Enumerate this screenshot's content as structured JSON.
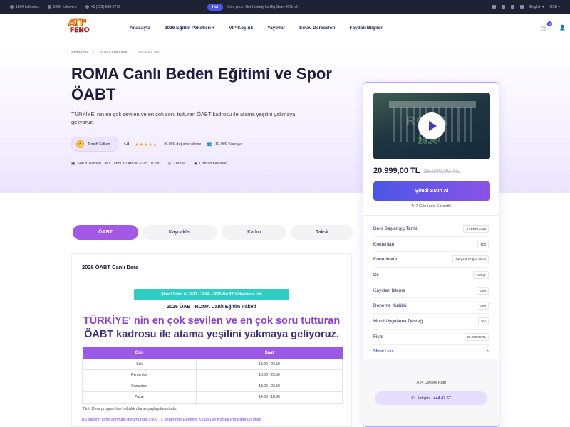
{
  "topbar": {
    "followers_1": "100K followers",
    "followers_2": "500K followers",
    "phone": "+1 (222) 666-0779",
    "promo_pill": "Hot",
    "promo_text": "Intro price. Get Histudy for Big Sale -95% off.",
    "language": "English",
    "currency": "USD"
  },
  "header": {
    "logo_top": "ATP",
    "logo_bottom": "FENO",
    "nav": [
      "Anasayfa",
      "2026 Eğitim Paketleri",
      "VIP Koçluk",
      "Yayınlar",
      "Sınav Dereceleri",
      "Faydalı Bilgiler"
    ],
    "cart_count": "0"
  },
  "breadcrumb": {
    "home": "Anasayfa",
    "category": "2026 Canlı Ders",
    "current": "ROMA Canlı"
  },
  "course": {
    "title": "ROMA Canlı Beden Eğitimi ve Spor ÖABT",
    "subtitle": "TÜRKİYE' nin en çok sevilen ve en çok soru tutturan ÖABT kadrosu ile atama yeşilini yakmaya geliyoruz.",
    "chip_label": "Tercih Edilen",
    "rating": "4.8",
    "stars": "★★★★★",
    "reviews": "+6.000 değerlendirme",
    "students": "+10.000 Kursiyer",
    "last_upload": "Son Yüklenen Ders Tarihi 10 Aralık 2025, 01:28",
    "language": "Türkçe",
    "instructors": "Uzman Hocalar"
  },
  "tabs": [
    "ÖABT",
    "Kaynaklar",
    "Kadro",
    "Taksit"
  ],
  "article": {
    "title": "2026 ÖABT Canlı Ders",
    "banner": "Şimdi Satın Al 2023 - 2024 - 2025 ÖABT Videolarını İzle",
    "package_title": "2026 ÖABT ROMA Canlı Eğitim Paketi",
    "slogan_part1": "TÜRKİYE' nin en çok sevilen ve en çok soru tutturan",
    "slogan_part2": "ÖABT kadrosu ile atama yeşilini yakmaya geliyoruz.",
    "table_headers": [
      "Gün",
      "Saat"
    ],
    "table_rows": [
      [
        "Salı",
        "18.00 - 23.50"
      ],
      [
        "Perşembe",
        "18.00 - 23.50"
      ],
      [
        "Cumartesi",
        "18.00 - 23.50"
      ],
      [
        "Pazar",
        "14.00 - 18.00"
      ]
    ],
    "note": "*Not: Ders programları haftalık olarak paylaşılmaktadır.",
    "note2": "Bu paketin satın alınması durumunda 7.500 TL değerinde Deneme Kulübü ve Koçluk Programı ücretsiz"
  },
  "sidebar": {
    "video_watermark": "ROMA",
    "video_year": "2026",
    "price": "20.999,00 TL",
    "old_price": "25.999,00 TL",
    "buy_label": "Şimdi Satın Al",
    "guarantee": "7 Gün İade Garantili",
    "specs": [
      {
        "label": "Ders Başlangıç Tarihi",
        "value": "27 Ekim 2025"
      },
      {
        "label": "Kontenjan",
        "value": "500"
      },
      {
        "label": "Koordinatör",
        "value": "Derya & Doğan Hoca"
      },
      {
        "label": "Dil",
        "value": "Türkçe"
      },
      {
        "label": "Kayıttan İzleme",
        "value": "Evet"
      },
      {
        "label": "Deneme Kulübü",
        "value": "Evet"
      },
      {
        "label": "Mobil Uygulama Desteği",
        "value": "Var"
      },
      {
        "label": "Fiyat",
        "value": "20.999,00 TL"
      }
    ],
    "show_less": "Show Less",
    "support_label": "7/24 Destek Hattı",
    "call_prefix": "İletişim:",
    "call_number": "444 42 67"
  },
  "colors": {
    "accent": "#4a56e8",
    "purple": "#a459e6",
    "topbar": "#1f2233",
    "banner": "#2ecec2"
  }
}
